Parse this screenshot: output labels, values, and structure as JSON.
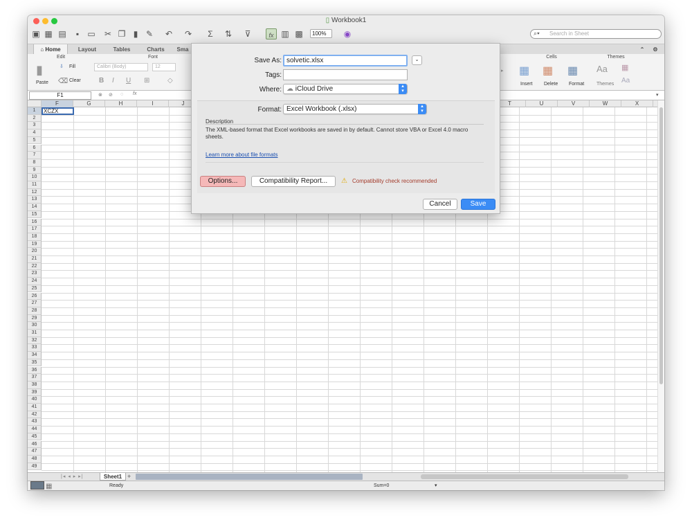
{
  "window": {
    "title": "Workbook1"
  },
  "toolbar": {
    "zoom": "100%",
    "search_placeholder": "Search in Sheet"
  },
  "ribbon": {
    "tabs": [
      "Home",
      "Layout",
      "Tables",
      "Charts",
      "Sma"
    ],
    "groups": {
      "edit": "Edit",
      "font": "Font",
      "cells": "Cells",
      "themes": "Themes"
    },
    "paste": "Paste",
    "fill": "Fill",
    "clear": "Clear",
    "font_name": "Calibri (Body)",
    "font_size": "12",
    "insert": "Insert",
    "delete": "Delete",
    "format": "Format",
    "themes_btn": "Themes"
  },
  "formula_bar": {
    "name_box": "F1",
    "fx": "fx"
  },
  "grid": {
    "left_columns": [
      "F",
      "G",
      "H",
      "I",
      "J"
    ],
    "right_columns": [
      "T",
      "U",
      "V",
      "W",
      "X"
    ],
    "cell_f1": "XCZX",
    "row_count": 49
  },
  "sheet_tab": "Sheet1",
  "sheet_add": "+",
  "status": {
    "ready": "Ready",
    "sum": "Sum=0"
  },
  "dialog": {
    "save_as_label": "Save As:",
    "save_as_value": "solvetic.xlsx",
    "tags_label": "Tags:",
    "where_label": "Where:",
    "where_value": "iCloud Drive",
    "format_label": "Format:",
    "format_value": "Excel Workbook (.xlsx)",
    "description_label": "Description",
    "description_text": "The XML-based format that Excel workbooks are saved in by default. Cannot store VBA or Excel 4.0 macro sheets.",
    "learn_more": "Learn more about file formats",
    "options_button": "Options...",
    "compat_button": "Compatibility Report...",
    "compat_warning": "Compatibility check recommended",
    "cancel_button": "Cancel",
    "save_button": "Save"
  },
  "colors": {
    "accent": "#3b8cf5",
    "warning": "#a33a2a",
    "link": "#1a4fb0",
    "options_bg": "#f5b8b8"
  }
}
